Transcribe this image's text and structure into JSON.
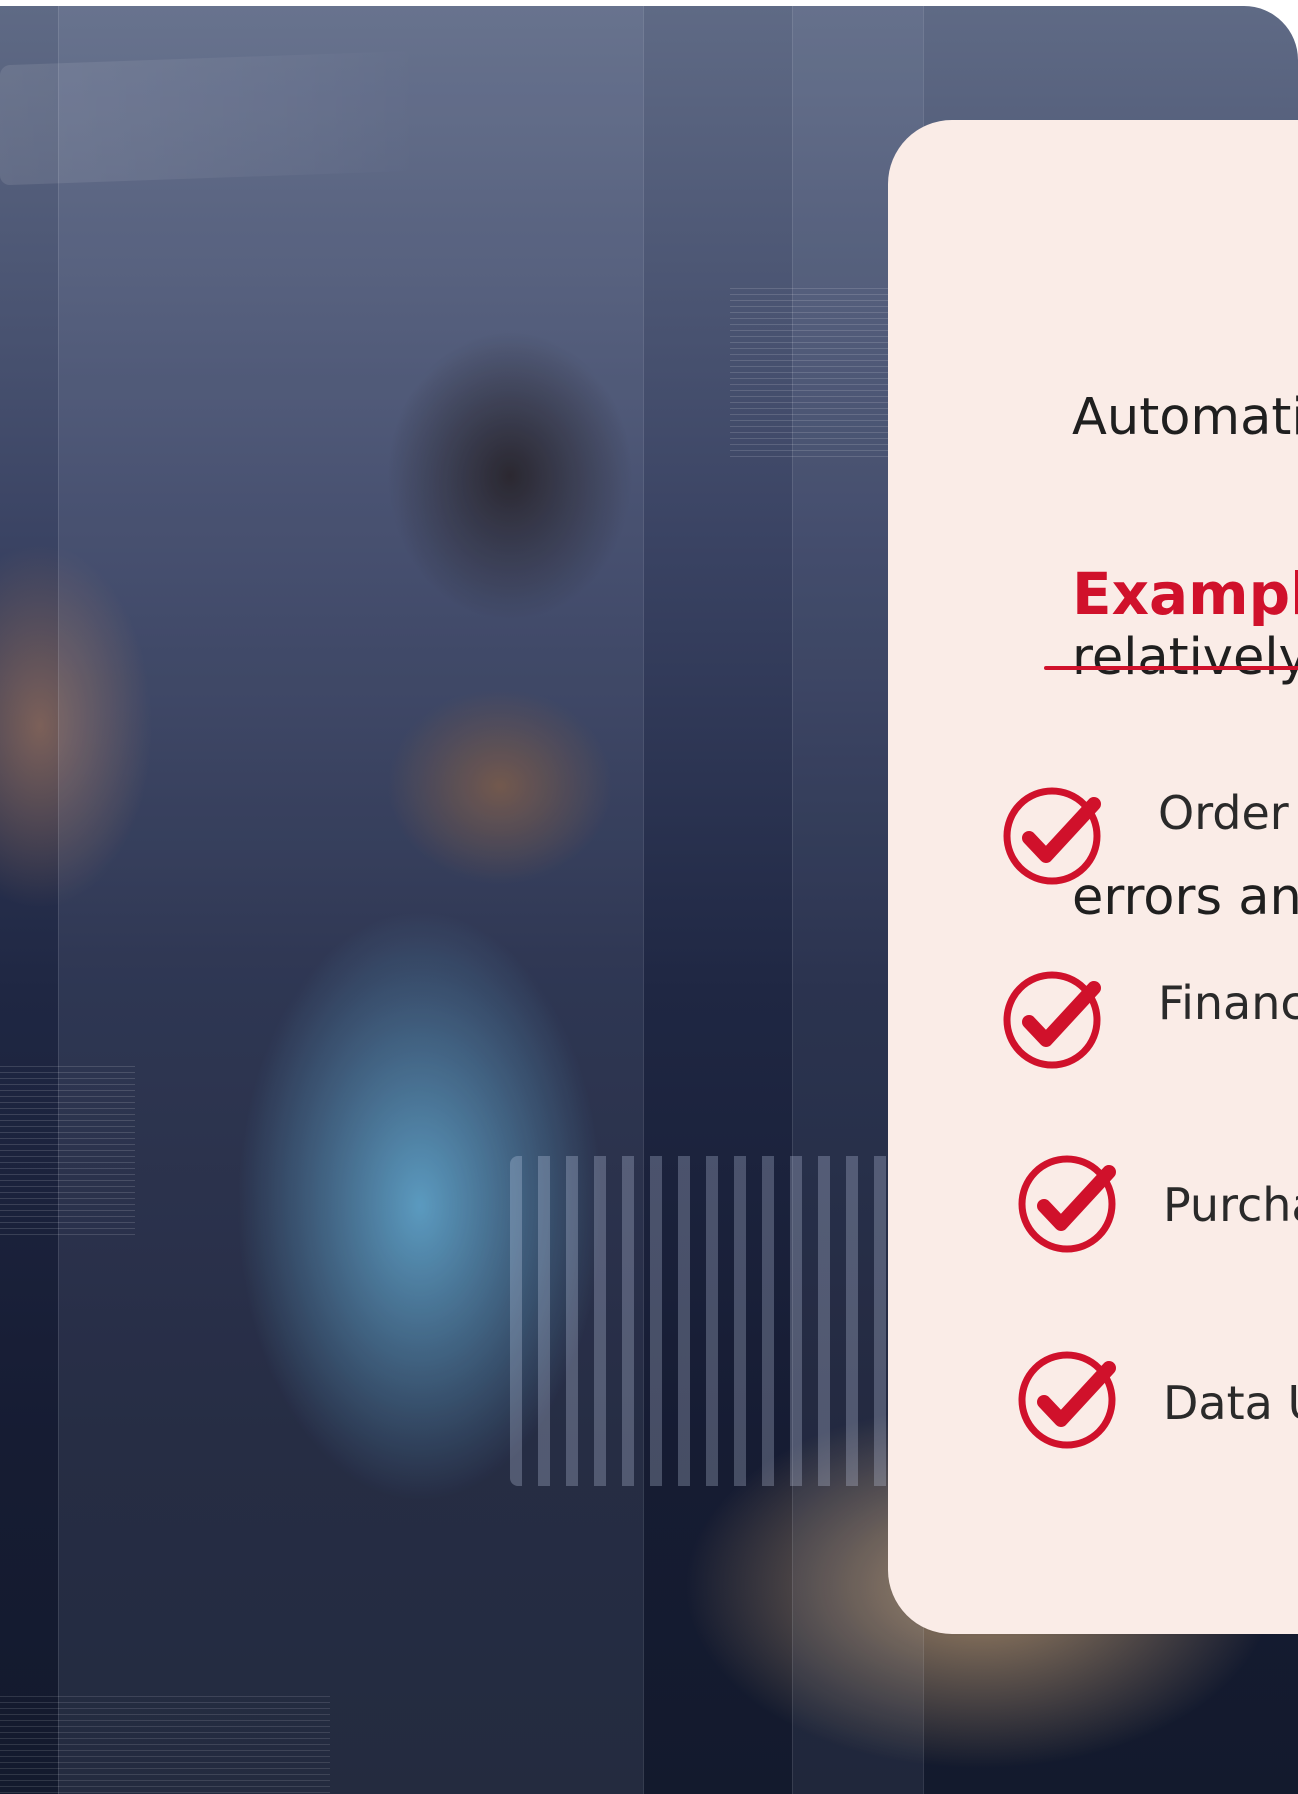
{
  "card": {
    "intro_lines": [
      "Automati",
      "relatively",
      "errors anc"
    ],
    "section_title": "Example",
    "items": [
      {
        "label": "Order I"
      },
      {
        "label": "Financ"
      },
      {
        "label": "Purcha"
      },
      {
        "label": "Data U"
      }
    ]
  },
  "colors": {
    "accent": "#d0112b",
    "card_background": "#faece7",
    "text": "#1f1f1f"
  },
  "icons": {
    "checkmark": "check-circle-icon"
  }
}
